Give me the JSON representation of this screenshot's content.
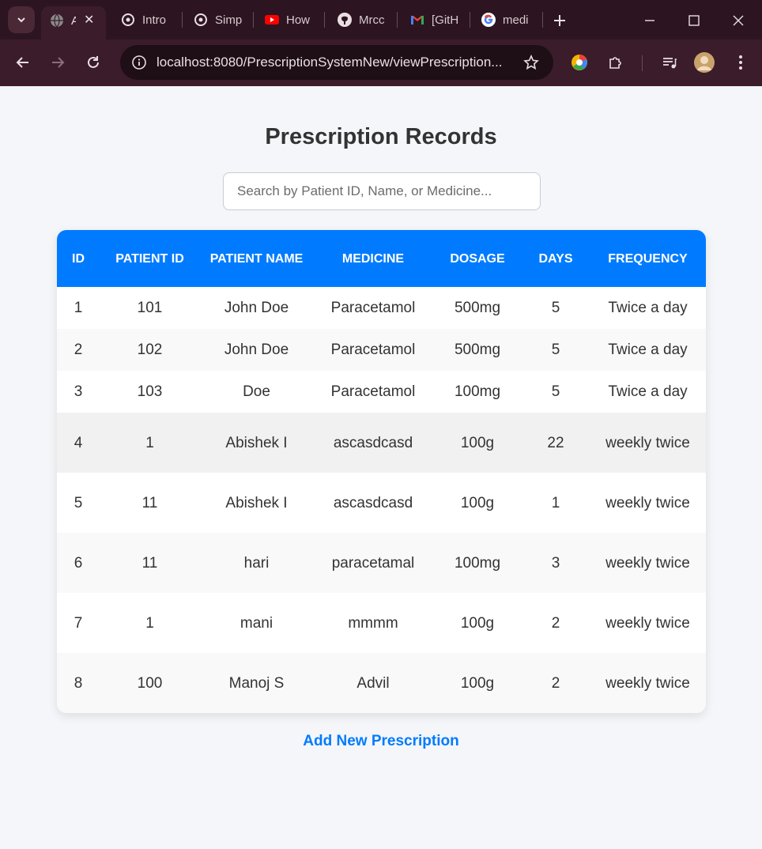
{
  "browser": {
    "tabs": [
      {
        "label": "A",
        "icon": "globe-icon"
      },
      {
        "label": "Intro",
        "icon": "openai-icon"
      },
      {
        "label": "Simp",
        "icon": "openai-icon"
      },
      {
        "label": "How",
        "icon": "youtube-icon"
      },
      {
        "label": "Mrcc",
        "icon": "github-icon"
      },
      {
        "label": "[GitH",
        "icon": "gmail-icon"
      },
      {
        "label": "medi",
        "icon": "google-icon"
      }
    ],
    "url": "localhost:8080/PrescriptionSystemNew/viewPrescription..."
  },
  "page": {
    "title": "Prescription Records",
    "search_placeholder": "Search by Patient ID, Name, or Medicine...",
    "add_link": "Add New Prescription"
  },
  "table": {
    "columns": [
      "ID",
      "Patient ID",
      "Patient Name",
      "Medicine",
      "Dosage",
      "Days",
      "Frequency"
    ],
    "rows": [
      [
        "1",
        "101",
        "John Doe",
        "Paracetamol",
        "500mg",
        "5",
        "Twice a day"
      ],
      [
        "2",
        "102",
        "John Doe",
        "Paracetamol",
        "500mg",
        "5",
        "Twice a day"
      ],
      [
        "3",
        "103",
        "Doe",
        "Paracetamol",
        "100mg",
        "5",
        "Twice a day"
      ],
      [
        "4",
        "1",
        "Abishek I",
        "ascasdcasd",
        "100g",
        "22",
        "weekly twice"
      ],
      [
        "5",
        "11",
        "Abishek I",
        "ascasdcasd",
        "100g",
        "1",
        "weekly twice"
      ],
      [
        "6",
        "11",
        "hari",
        "paracetamal",
        "100mg",
        "3",
        "weekly twice"
      ],
      [
        "7",
        "1",
        "mani",
        "mmmm",
        "100g",
        "2",
        "weekly twice"
      ],
      [
        "8",
        "100",
        "Manoj S",
        "Advil",
        "100g",
        "2",
        "weekly twice"
      ]
    ]
  },
  "colors": {
    "header": "#007bff",
    "chrome": "#3b1c2a",
    "link": "#007bff"
  }
}
